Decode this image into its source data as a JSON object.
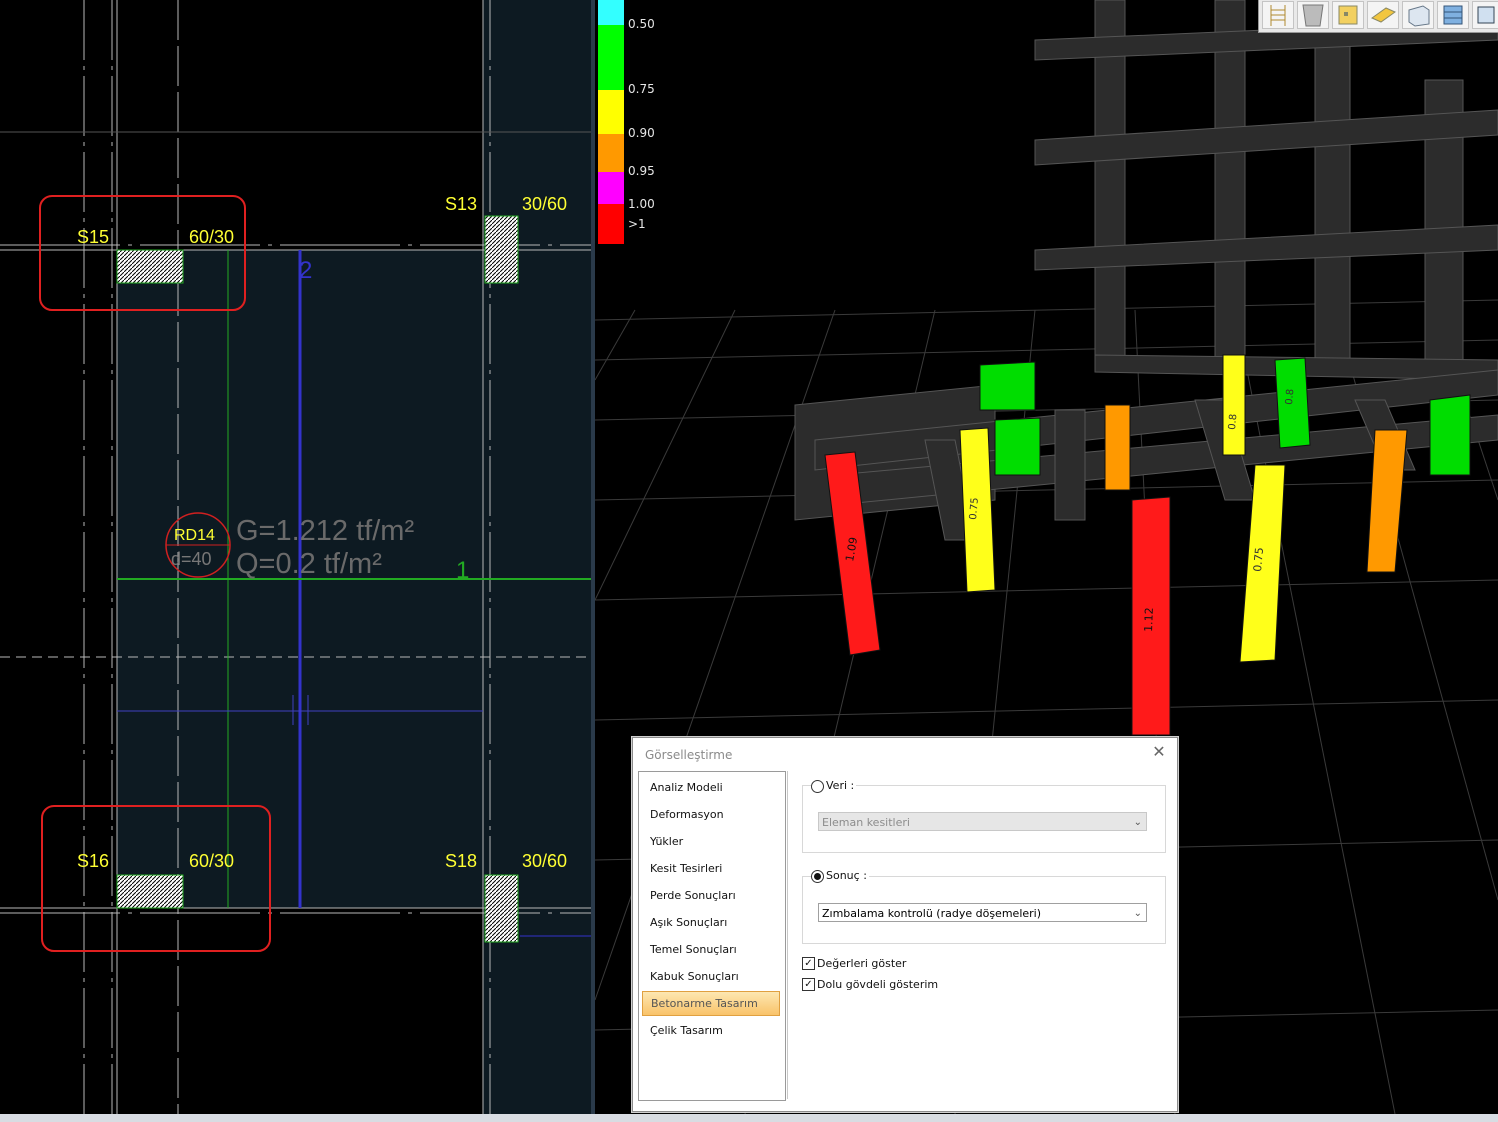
{
  "cad": {
    "columns": [
      {
        "id": "S15",
        "size": "60/30"
      },
      {
        "id": "S13",
        "size": "30/60"
      },
      {
        "id": "S16",
        "size": "60/30"
      },
      {
        "id": "S18",
        "size": "30/60"
      }
    ],
    "slab": {
      "id": "RD14",
      "thickness": "d=40",
      "g_load": "G=1.212 tf/m²",
      "q_load": "Q=0.2 tf/m²"
    },
    "axes": {
      "vertical": "2",
      "horizontal": "1"
    }
  },
  "legend": {
    "items": [
      {
        "label": "0.50",
        "color": "#33ffff"
      },
      {
        "label": "0.75",
        "color": "#00ff00"
      },
      {
        "label": "0.90",
        "color": "#ffff00"
      },
      {
        "label": "0.95",
        "color": "#ff9900"
      },
      {
        "label": "1.00",
        "color": "#ff00ff"
      },
      {
        "label": ">1",
        "color": "#ff0000"
      }
    ]
  },
  "model3d": {
    "column_values": [
      "1.09",
      "1.12",
      "0.75",
      "0.75",
      "0.8",
      "0.8"
    ]
  },
  "toolbar": {
    "icons": [
      "ladder-icon",
      "curtain-icon",
      "panel-icon",
      "beam-icon",
      "box-icon",
      "wall-icon",
      "cube-icon"
    ]
  },
  "dialog": {
    "title": "Görselleştirme",
    "nav_items": [
      "Analiz Modeli",
      "Deformasyon",
      "Yükler",
      "Kesit Tesirleri",
      "Perde Sonuçları",
      "Aşık Sonuçları",
      "Temel Sonuçları",
      "Kabuk Sonuçları",
      "Betonarme Tasarım",
      "Çelik Tasarım"
    ],
    "active_index": 8,
    "data_group": {
      "label": "Veri :",
      "select_value": "Eleman kesitleri"
    },
    "result_group": {
      "label": "Sonuç :",
      "select_value": "Zımbalama kontrolü (radye döşemeleri)"
    },
    "show_values_label": "Değerleri göster",
    "solid_body_label": "Dolu gövdeli gösterim"
  }
}
